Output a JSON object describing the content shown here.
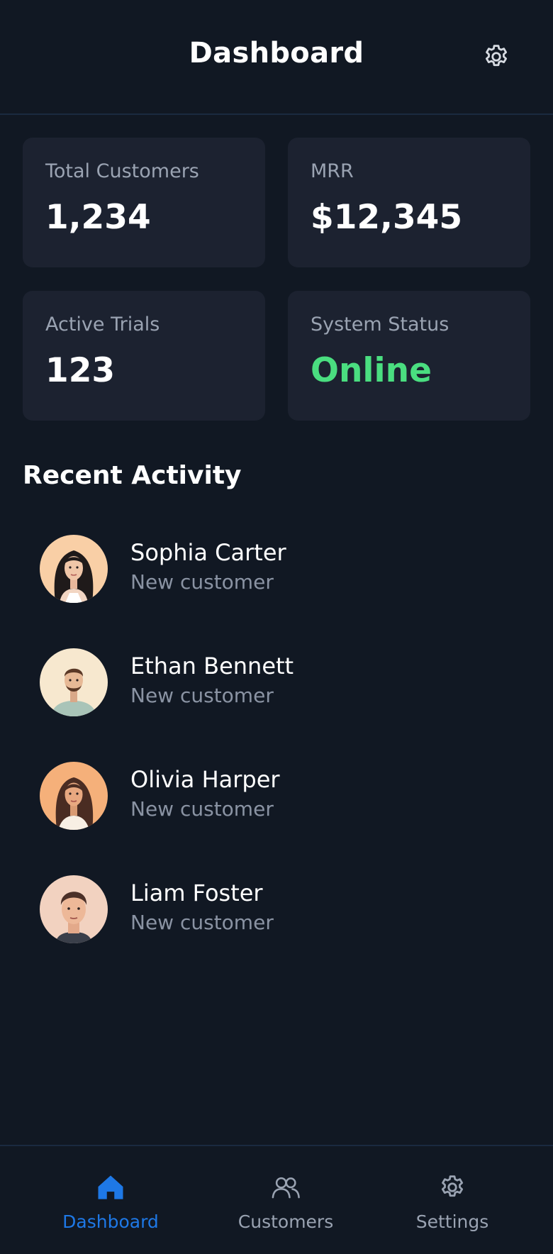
{
  "header": {
    "title": "Dashboard",
    "settings_icon": "gear-icon"
  },
  "stats": [
    {
      "label": "Total Customers",
      "value": "1,234"
    },
    {
      "label": "MRR",
      "value": "$12,345"
    },
    {
      "label": "Active Trials",
      "value": "123"
    },
    {
      "label": "System Status",
      "value": "Online",
      "status_color": "#4ade80"
    }
  ],
  "recent_activity": {
    "title": "Recent Activity",
    "items": [
      {
        "name": "Sophia Carter",
        "subtitle": "New customer",
        "avatar_bg": "#f9cfa6"
      },
      {
        "name": "Ethan Bennett",
        "subtitle": "New customer",
        "avatar_bg": "#f7e8cf"
      },
      {
        "name": "Olivia Harper",
        "subtitle": "New customer",
        "avatar_bg": "#f5b07a"
      },
      {
        "name": "Liam Foster",
        "subtitle": "New customer",
        "avatar_bg": "#f2d2c0"
      }
    ]
  },
  "bottom_nav": {
    "items": [
      {
        "label": "Dashboard",
        "icon": "home-icon",
        "active": true
      },
      {
        "label": "Customers",
        "icon": "users-icon",
        "active": false
      },
      {
        "label": "Settings",
        "icon": "gear-icon",
        "active": false
      }
    ],
    "active_color": "#1e78e6"
  },
  "colors": {
    "background": "#111823",
    "card": "#1c2230",
    "accent": "#1e78e6",
    "online": "#4ade80"
  }
}
